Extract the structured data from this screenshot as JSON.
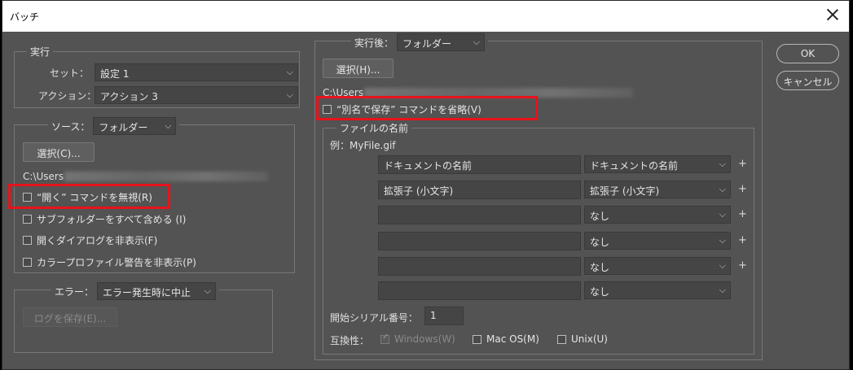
{
  "window": {
    "title": "バッチ"
  },
  "buttons": {
    "ok": "OK",
    "cancel": "キャンセル"
  },
  "play": {
    "legend": "実行",
    "set_label": "セット：",
    "set_value": "設定 1",
    "action_label": "アクション：",
    "action_value": "アクション 3"
  },
  "source": {
    "legend_label": "ソース：",
    "value": "フォルダー",
    "choose_button": "選択(C)...",
    "path": "C:\\Users",
    "checkboxes": [
      {
        "label": "“開く” コマンドを無視(R)",
        "checked": false
      },
      {
        "label": "サブフォルダーをすべて含める (I)",
        "checked": false
      },
      {
        "label": "開くダイアログを非表示(F)",
        "checked": false
      },
      {
        "label": "カラープロファイル警告を非表示(P)",
        "checked": false
      }
    ]
  },
  "errors": {
    "legend_label": "エラー：",
    "value": "エラー発生時に中止",
    "save_log_button": "ログを保存(E)..."
  },
  "destination": {
    "legend_label": "実行後：",
    "value": "フォルダー",
    "choose_button": "選択(H)...",
    "path": "C:\\Users",
    "override_save_as": "“別名で保存” コマンドを省略(V)"
  },
  "file_naming": {
    "legend": "ファイルの名前",
    "example": "例：MyFile.gif",
    "rows": [
      {
        "text": "ドキュメントの名前",
        "select": "ドキュメントの名前",
        "plus": "+"
      },
      {
        "text": "拡張子 (小文字)",
        "select": "拡張子 (小文字)",
        "plus": "+"
      },
      {
        "text": "",
        "select": "なし",
        "plus": "+"
      },
      {
        "text": "",
        "select": "なし",
        "plus": "+"
      },
      {
        "text": "",
        "select": "なし",
        "plus": "+"
      },
      {
        "text": "",
        "select": "なし",
        "plus": ""
      }
    ],
    "serial_label": "開始シリアル番号：",
    "serial_value": "1",
    "compat_label": "互換性：",
    "compat_windows": "Windows(W)",
    "compat_mac": "Mac OS(M)",
    "compat_unix": "Unix(U)"
  },
  "colors": {
    "highlight": "#e8131b",
    "panel": "#535353"
  }
}
